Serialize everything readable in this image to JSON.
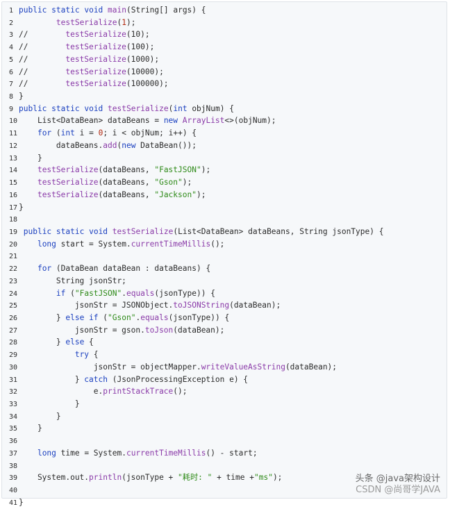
{
  "lines": [
    {
      "n": "1",
      "t": "public static void main(String[] args) {"
    },
    {
      "n": "2",
      "t": "        testSerialize(1);"
    },
    {
      "n": "3",
      "t": "//        testSerialize(10);"
    },
    {
      "n": "4",
      "t": "//        testSerialize(100);"
    },
    {
      "n": "5",
      "t": "//        testSerialize(1000);"
    },
    {
      "n": "6",
      "t": "//        testSerialize(10000);"
    },
    {
      "n": "7",
      "t": "//        testSerialize(100000);"
    },
    {
      "n": "8",
      "t": "}"
    },
    {
      "n": "9",
      "t": "public static void testSerialize(int objNum) {"
    },
    {
      "n": "10",
      "t": "    List<DataBean> dataBeans = new ArrayList<>(objNum);"
    },
    {
      "n": "11",
      "t": "    for (int i = 0; i < objNum; i++) {"
    },
    {
      "n": "12",
      "t": "        dataBeans.add(new DataBean());"
    },
    {
      "n": "13",
      "t": "    }"
    },
    {
      "n": "14",
      "t": "    testSerialize(dataBeans, \"FastJSON\");"
    },
    {
      "n": "15",
      "t": "    testSerialize(dataBeans, \"Gson\");"
    },
    {
      "n": "16",
      "t": "    testSerialize(dataBeans, \"Jackson\");"
    },
    {
      "n": "17",
      "t": "}"
    },
    {
      "n": "18",
      "t": ""
    },
    {
      "n": "19",
      "t": " public static void testSerialize(List<DataBean> dataBeans, String jsonType) {"
    },
    {
      "n": "20",
      "t": "    long start = System.currentTimeMillis();"
    },
    {
      "n": "21",
      "t": ""
    },
    {
      "n": "22",
      "t": "    for (DataBean dataBean : dataBeans) {"
    },
    {
      "n": "23",
      "t": "        String jsonStr;"
    },
    {
      "n": "24",
      "t": "        if (\"FastJSON\".equals(jsonType)) {"
    },
    {
      "n": "25",
      "t": "            jsonStr = JSONObject.toJSONString(dataBean);"
    },
    {
      "n": "26",
      "t": "        } else if (\"Gson\".equals(jsonType)) {"
    },
    {
      "n": "27",
      "t": "            jsonStr = gson.toJson(dataBean);"
    },
    {
      "n": "28",
      "t": "        } else {"
    },
    {
      "n": "29",
      "t": "            try {"
    },
    {
      "n": "30",
      "t": "                jsonStr = objectMapper.writeValueAsString(dataBean);"
    },
    {
      "n": "31",
      "t": "            } catch (JsonProcessingException e) {"
    },
    {
      "n": "32",
      "t": "                e.printStackTrace();"
    },
    {
      "n": "33",
      "t": "            }"
    },
    {
      "n": "34",
      "t": "        }"
    },
    {
      "n": "35",
      "t": "    }"
    },
    {
      "n": "36",
      "t": ""
    },
    {
      "n": "37",
      "t": "    long time = System.currentTimeMillis() - start;"
    },
    {
      "n": "38",
      "t": ""
    },
    {
      "n": "39",
      "t": "    System.out.println(jsonType + \"耗时: \" + time +\"ms\");"
    },
    {
      "n": "40",
      "t": ""
    },
    {
      "n": "41",
      "t": "}"
    }
  ],
  "watermark": {
    "line1": "头条 @java架构设计",
    "line2": "CSDN @尚哥学JAVA"
  },
  "colors": {
    "keyword": "#1a3fbf",
    "method": "#8a3aa8",
    "string": "#2e8a18",
    "number": "#b0260c"
  }
}
